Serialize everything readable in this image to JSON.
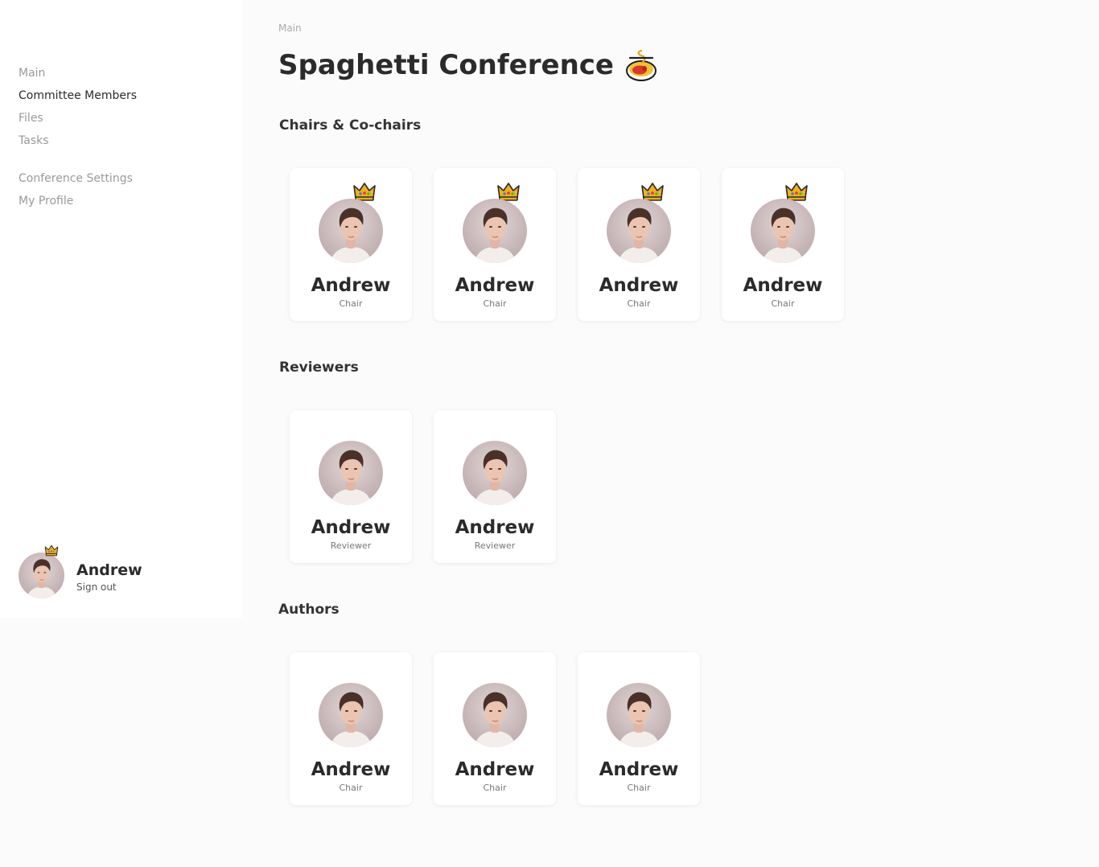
{
  "sidebar": {
    "nav_main": [
      {
        "label": "Main",
        "active": false
      },
      {
        "label": "Committee Members",
        "active": true
      },
      {
        "label": "Files",
        "active": false
      },
      {
        "label": "Tasks",
        "active": false
      }
    ],
    "nav_secondary": [
      {
        "label": "Conference Settings",
        "active": false
      },
      {
        "label": "My Profile",
        "active": false
      }
    ],
    "user": {
      "name": "Andrew",
      "sign_out": "Sign out",
      "has_crown": true
    }
  },
  "main": {
    "breadcrumb": "Main",
    "title": "Spaghetti Conference",
    "title_icon": "spaghetti-bowl-icon",
    "sections": [
      {
        "title": "Chairs & Co-chairs",
        "members": [
          {
            "name": "Andrew",
            "role": "Chair",
            "crown": true
          },
          {
            "name": "Andrew",
            "role": "Chair",
            "crown": true
          },
          {
            "name": "Andrew",
            "role": "Chair",
            "crown": true
          },
          {
            "name": "Andrew",
            "role": "Chair",
            "crown": true
          }
        ]
      },
      {
        "title": "Reviewers",
        "members": [
          {
            "name": "Andrew",
            "role": "Reviewer",
            "crown": false
          },
          {
            "name": "Andrew",
            "role": "Reviewer",
            "crown": false
          }
        ]
      },
      {
        "title": "Authors",
        "members": [
          {
            "name": "Andrew",
            "role": "Chair",
            "crown": false
          },
          {
            "name": "Andrew",
            "role": "Chair",
            "crown": false
          },
          {
            "name": "Andrew",
            "role": "Chair",
            "crown": false
          }
        ]
      }
    ]
  },
  "colors": {
    "background": "#fbfbfb",
    "sidebar": "#ffffff",
    "text": "#2b2b2b",
    "muted": "#9a9a9a",
    "crown": "#f2b01e"
  }
}
